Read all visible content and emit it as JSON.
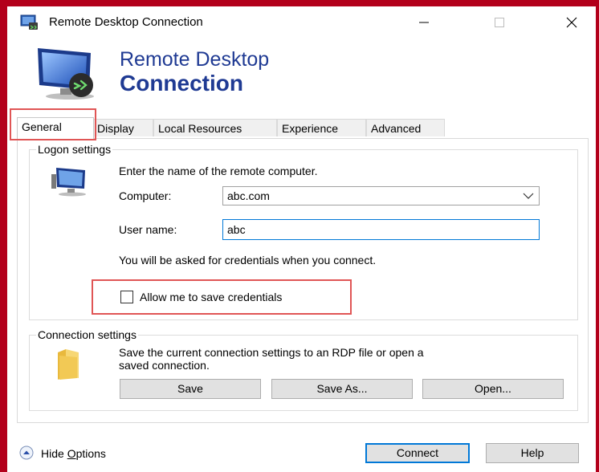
{
  "window": {
    "title": "Remote Desktop Connection",
    "controls": {
      "minimize": "—",
      "maximize": "☐",
      "close": "✕"
    }
  },
  "banner": {
    "line1": "Remote Desktop",
    "line2": "Connection"
  },
  "tabs": [
    {
      "label": "General",
      "active": true
    },
    {
      "label": "Display"
    },
    {
      "label": "Local Resources"
    },
    {
      "label": "Experience"
    },
    {
      "label": "Advanced"
    }
  ],
  "logon": {
    "legend": "Logon settings",
    "instruction": "Enter the name of the remote computer.",
    "computer_label": "Computer:",
    "computer_value": "abc.com",
    "username_label": "User name:",
    "username_value": "abc",
    "credentials_note": "You will be asked for credentials when you connect.",
    "save_credentials_label": "Allow me to save credentials",
    "save_credentials_checked": false
  },
  "connection": {
    "legend": "Connection settings",
    "description_line1": "Save the current connection settings to an RDP file or open a",
    "description_line2": "saved connection.",
    "save_button": "Save",
    "save_as_button": "Save As...",
    "open_button": "Open..."
  },
  "footer": {
    "hide_options_prefix": "Hide ",
    "hide_options_underlined": "O",
    "hide_options_rest": "ptions",
    "connect_button": "Connect",
    "help_button": "Help"
  },
  "colors": {
    "brand": "#1f3a93",
    "highlight": "#e05555",
    "focus": "#0078d7",
    "frame": "#b3001b"
  },
  "icons": [
    "remote-desktop-icon",
    "computer-icon",
    "folder-icon",
    "chevron-down-icon",
    "chevron-up-circle-icon"
  ]
}
